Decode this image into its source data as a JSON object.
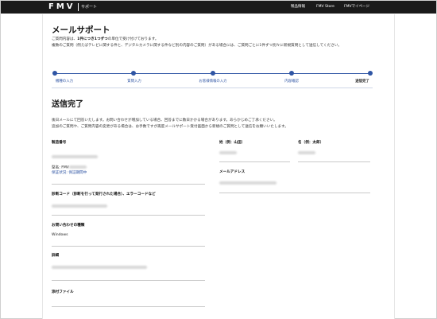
{
  "header": {
    "logo": "FMV",
    "logo_sub": "サポート",
    "nav": [
      "製品情報",
      "FMV Store",
      "FMVマイページ"
    ]
  },
  "page": {
    "title": "メールサポート",
    "intro_line1_prefix": "ご質問内容は、",
    "intro_line1_bold": "1件につき1つずつ",
    "intro_line1_suffix": "の単位で受け付けております。",
    "intro_line2": "複数のご質問（例えばテレビに関する件と、デジタルカメラに関する件など別の内容のご質問）がある場合には、ご質問ごとに1件ずつ別々に新規質問として送信してください。"
  },
  "steps": [
    {
      "label": "機種の入力"
    },
    {
      "label": "質問入力"
    },
    {
      "label": "お客様情報の入力"
    },
    {
      "label": "内容確認"
    },
    {
      "label": "送信完了"
    }
  ],
  "completion": {
    "title": "送信完了",
    "line1": "後日メールにて回答いたします。お問い合わせが増加している場合、回答までに数日かかる場合があります。あらかじめご了承ください。",
    "line2": "追加のご質問や、ご質問内容の変更がある場合は、お手数ですが再度メールサポート受付画面から新規のご質問として送信をお願いいたします。"
  },
  "fields": {
    "serial_label": "製造番号",
    "model_prefix": "型名: FMV",
    "warranty": "保証状況: 保証期間中",
    "error_code_label": "診断コード（診断を行って発行された場合）、エラーコードなど",
    "inquiry_type_label": "お問い合わせの種類",
    "inquiry_type_value": "Windows",
    "details_label": "詳細",
    "attachment_label": "添付ファイル",
    "last_name_label": "姓（例：山田）",
    "first_name_label": "名（例：太郎）",
    "email_label": "メールアドレス"
  }
}
